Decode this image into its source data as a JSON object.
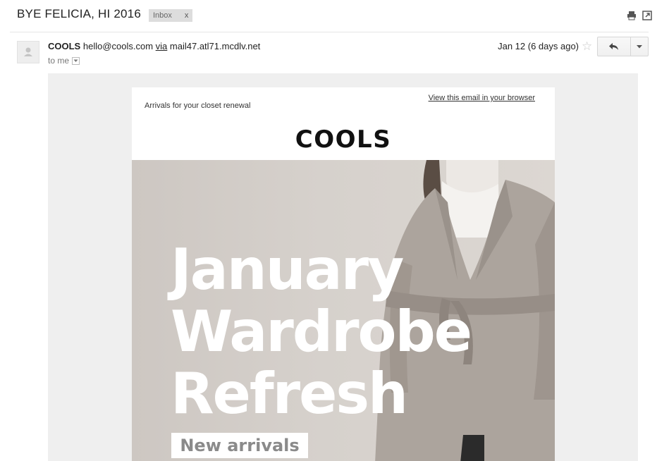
{
  "thread": {
    "subject": "BYE FELICIA, HI 2016",
    "label": "Inbox",
    "label_close": "x"
  },
  "message": {
    "sender_name": "COOLS",
    "sender_email": "hello@cools.com",
    "via_label": "via",
    "via_domain": "mail47.atl71.mcdlv.net",
    "recipient": "to me",
    "date": "Jan 12 (6 days ago)"
  },
  "email": {
    "preheader": "Arrivals for your closet renewal",
    "view_in_browser": "View this email in your browser",
    "brand_logo": "COOLS",
    "headline_lines": [
      "January",
      "Wardrobe",
      "Refresh"
    ],
    "cta_label": "New arrivals"
  },
  "icons": {
    "print": "print-icon",
    "popout": "popout-icon",
    "avatar": "person-icon",
    "star": "star-icon",
    "reply": "reply-icon",
    "more": "chevron-down-icon"
  },
  "colors": {
    "label_bg": "#dddddd",
    "mail_body_bg": "#efefef",
    "hero_bg": "#d6d1cc",
    "coat": "#aca49d",
    "cta_text": "#8a8a8a"
  }
}
